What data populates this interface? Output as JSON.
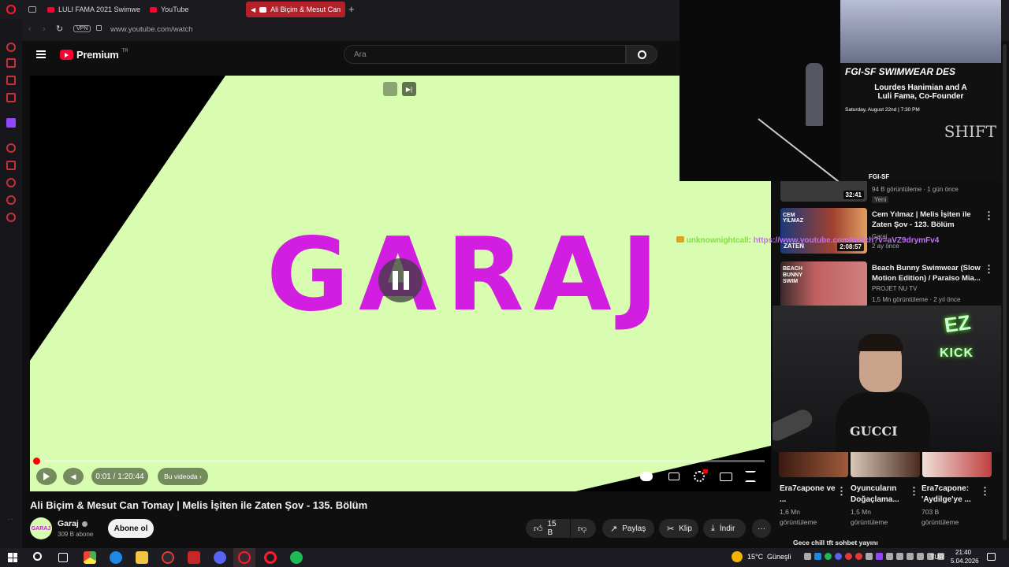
{
  "browser": {
    "tabs": [
      {
        "label": "LULI FAMA 2021 Swimwea"
      },
      {
        "label": "YouTube"
      },
      {
        "label": "Ali Biçim & Mesut Can"
      }
    ],
    "url": "www.youtube.com/watch",
    "vpn_label": "VPN"
  },
  "youtube": {
    "logo_text": "Premium",
    "region": "TR",
    "search_placeholder": "Ara"
  },
  "player": {
    "logo_text": "GARAJ",
    "time": "0:01 / 1:20:44",
    "chapter_label": "Bu videoda",
    "progress": 0.0002,
    "state": "paused-overlay"
  },
  "video": {
    "title": "Ali Biçim & Mesut Can Tomay | Melis İşiten ile Zaten Şov - 135. Bölüm",
    "channel": "Garaj",
    "channel_avatar_text": "GARAJ",
    "subscribers": "309 B abone",
    "subscribe_label": "Abone ol",
    "likes": "15 B",
    "share_label": "Paylaş",
    "clip_label": "Klip",
    "download_label": "İndir"
  },
  "overlay": {
    "event_title": "FGI-SF SWIMWEAR DES",
    "event_sub1": "Lourdes Hanimian and A",
    "event_sub2": "Luli Fama, Co-Founder",
    "event_date": "Saturday, August 22nd | 7:30 PM",
    "event_brand": "SHIFT",
    "event_peek": "FGI-SF",
    "chat_user": "unknownightcall",
    "chat_text": ": https://www.youtube.com/watch?v=aVZ9drymFv4",
    "kick_ez": "EZ",
    "kick_label": "KICK",
    "shirt_text": "GUCCI"
  },
  "recommendations": [
    {
      "meta1": "94 B görüntüleme · 1 gün önce",
      "badge": "Yeni",
      "duration": "32:41"
    },
    {
      "title": "Cem Yılmaz | Melis İşiten ile Zaten Şov - 123. Bölüm",
      "channel": "Garaj",
      "meta": "2 ay önce",
      "duration": "2:08:57",
      "thumb_text1": "CEM YILMAZ",
      "thumb_text2": "ZATEN"
    },
    {
      "title": "Beach Bunny Swimwear (Slow Motion Edition) / Paraiso Mia...",
      "channel": "PROJET NU TV",
      "meta": "1,5 Mn görüntüleme · 2 yıl önce",
      "thumb_text": "BEACH BUNNY SWIM"
    }
  ],
  "shorts": [
    {
      "title": "Era7capone ve ...",
      "views": "1,6 Mn görüntüleme"
    },
    {
      "title": "Oyuncuların Doğaçlama...",
      "views": "1,5 Mn görüntüleme"
    },
    {
      "title": "Era7capone: 'Aydilge'ye ...",
      "views": "703 B görüntüleme"
    }
  ],
  "next_peek": "Gece chill tft sohbet yayını",
  "taskbar": {
    "weather": "15°C",
    "weather_text": "Güneşli",
    "lang": "TUR",
    "time": "21:40",
    "date": "5.04.2026"
  },
  "colors": {
    "player_bg": "#d8fcb0",
    "garaj_magenta": "#d21ee0",
    "progress_red": "#ff0000",
    "brand_red": "#ff0033"
  }
}
